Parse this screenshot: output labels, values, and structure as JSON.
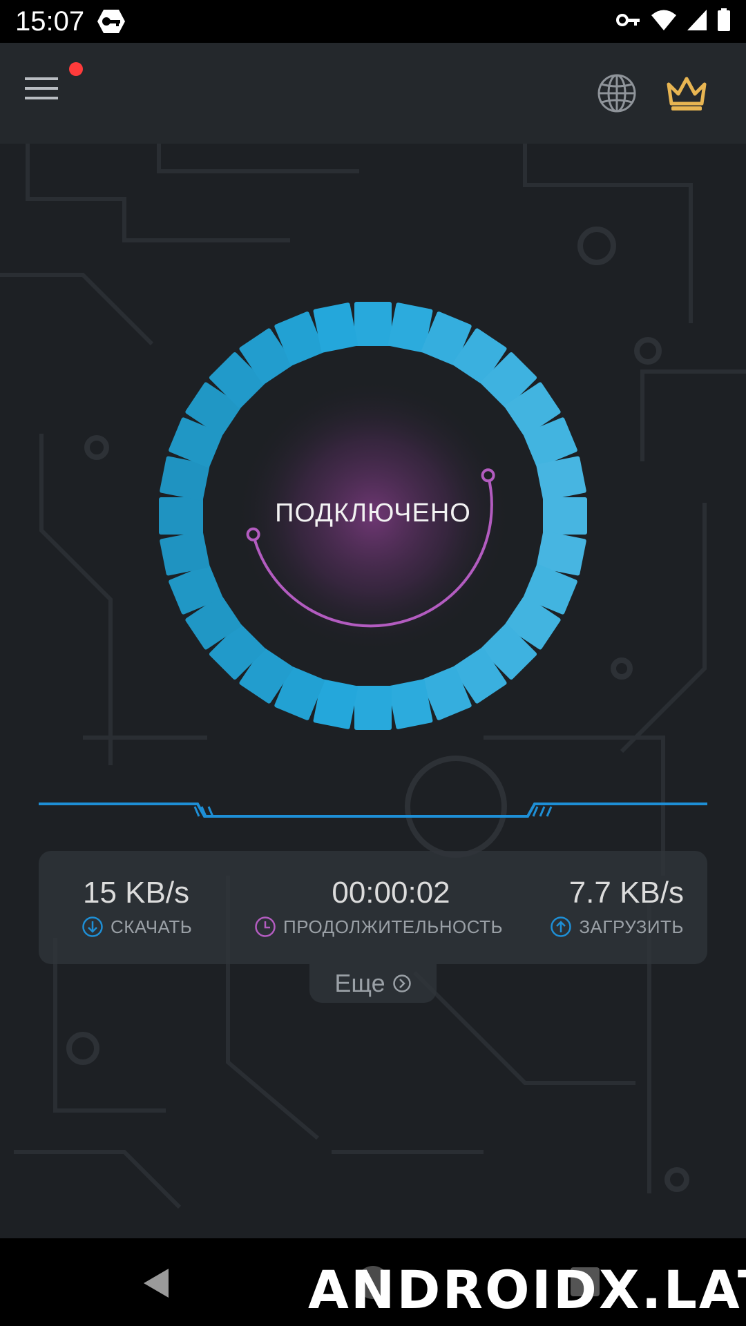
{
  "status_bar": {
    "time": "15:07"
  },
  "app_bar": {
    "icons": [
      "menu-icon",
      "globe-icon",
      "crown-icon"
    ],
    "notification_dot_color": "#ff3b3b"
  },
  "connection": {
    "status": "ПОДКЛЮЧЕНО",
    "ring_color": "#2aa8dc",
    "inner_ring_color": "#b35cc0"
  },
  "stats": {
    "download": {
      "value": "15 KB/s",
      "label": "СКАЧАТЬ",
      "icon": "download-icon",
      "icon_color": "#1e8fd6"
    },
    "duration": {
      "value": "00:00:02",
      "label": "ПРОДОЛЖИТЕЛЬНОСТЬ",
      "icon": "clock-icon",
      "icon_color": "#b35cc0"
    },
    "upload": {
      "value": "7.7 KB/s",
      "label": "ЗАГРУЗИТЬ",
      "icon": "upload-icon",
      "icon_color": "#1e8fd6"
    }
  },
  "more": {
    "label": "Еще",
    "icon": "chevron-right-circle-icon"
  },
  "watermark": "ANDROIDX.LAT",
  "nav_bar": {
    "icons": [
      "back-icon",
      "home-icon",
      "recents-icon"
    ]
  }
}
